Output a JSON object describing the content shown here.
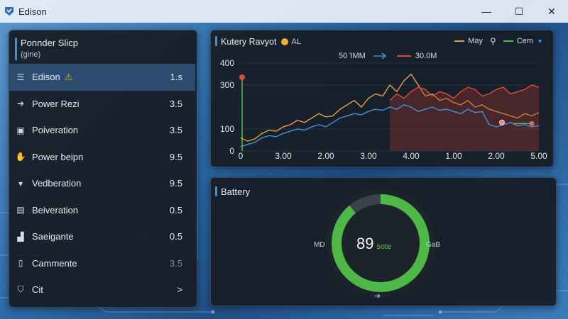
{
  "window": {
    "title": "Edison",
    "controls": {
      "minimize": "—",
      "maximize": "☐",
      "close": "✕"
    }
  },
  "sidebar": {
    "title": "Ponnder Slicp",
    "subtitle": "(gine)",
    "items": [
      {
        "icon": "list-icon",
        "glyph": "☰",
        "label": "Edison",
        "value": "1.s",
        "warning": true,
        "active": true
      },
      {
        "icon": "arrow-right-icon",
        "glyph": "➔",
        "label": "Power Rezi",
        "value": "3.5"
      },
      {
        "icon": "image-icon",
        "glyph": "▣",
        "label": "Poiveration",
        "value": "3.5"
      },
      {
        "icon": "hand-icon",
        "glyph": "✋",
        "label": "Power beipn",
        "value": "9.5"
      },
      {
        "icon": "box-icon",
        "glyph": "▾",
        "label": "Vedberation",
        "value": "9.5"
      },
      {
        "icon": "document-icon",
        "glyph": "▤",
        "label": "Beiveration",
        "value": "0.5"
      },
      {
        "icon": "terminal-icon",
        "glyph": "▟",
        "label": "Saeigante",
        "value": "0.5"
      },
      {
        "icon": "battery-icon",
        "glyph": "▯",
        "label": "Cammente",
        "value": "3.5",
        "dim": true
      },
      {
        "icon": "shield-icon",
        "glyph": "⛉",
        "label": "Cit",
        "value": ">"
      }
    ]
  },
  "chart_panel": {
    "title": "Kutery Ravyot",
    "title_suffix": "AL",
    "legend": [
      {
        "name": "May",
        "color": "#e8a040"
      },
      {
        "name": "Cem",
        "color": "#4fbf4f"
      }
    ],
    "subhead_left": "50 ΊMM",
    "subhead_right": "30.0M"
  },
  "chart_data": {
    "type": "line",
    "x_ticks": [
      "0",
      "3.00",
      "2.00",
      "3.00",
      "4.00",
      "1.00",
      "2.00",
      "5.00"
    ],
    "y_ticks": [
      "0",
      "100",
      "300",
      "400"
    ],
    "ylim": [
      0,
      400
    ],
    "series": [
      {
        "color": "#e8a040",
        "values": [
          60,
          45,
          55,
          80,
          95,
          90,
          110,
          120,
          140,
          130,
          150,
          170,
          155,
          160,
          190,
          210,
          230,
          200,
          240,
          260,
          250,
          300,
          270,
          320,
          350,
          300,
          250,
          260,
          230,
          240,
          220,
          210,
          230,
          200,
          210,
          190,
          180,
          170,
          160,
          150,
          170,
          160,
          175
        ]
      },
      {
        "color": "#e04a3a",
        "values": [
          0,
          0,
          0,
          0,
          0,
          0,
          0,
          0,
          0,
          0,
          0,
          0,
          0,
          0,
          0,
          0,
          0,
          0,
          0,
          0,
          0,
          230,
          260,
          240,
          270,
          290,
          280,
          250,
          270,
          260,
          240,
          270,
          290,
          280,
          250,
          260,
          280,
          290,
          260,
          270,
          280,
          300,
          290
        ]
      },
      {
        "color": "#4a8fd8",
        "values": [
          20,
          30,
          40,
          60,
          70,
          65,
          80,
          90,
          100,
          95,
          110,
          120,
          110,
          130,
          150,
          160,
          170,
          165,
          180,
          190,
          185,
          200,
          190,
          210,
          200,
          180,
          190,
          200,
          185,
          190,
          180,
          170,
          190,
          175,
          180,
          120,
          110,
          120,
          130,
          115,
          120,
          110,
          115
        ]
      }
    ]
  },
  "battery_panel": {
    "title": "Battery",
    "value": "89",
    "unit": "sote",
    "percent": 0.89,
    "left_label": "MD",
    "right_label": "GaB",
    "footer": "➔"
  }
}
